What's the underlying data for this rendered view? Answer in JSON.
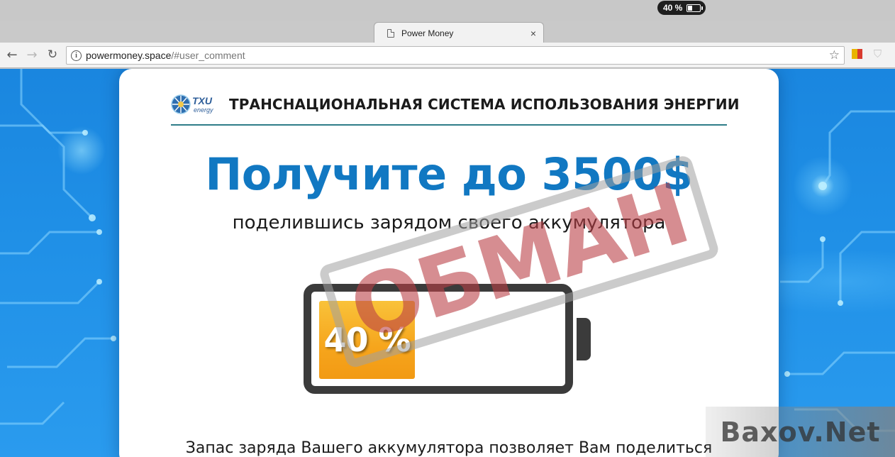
{
  "system": {
    "battery_text": "40 %",
    "battery_level": 0.4
  },
  "browser": {
    "tab": {
      "title": "Power Money",
      "close_glyph": "×",
      "icon": "page-icon"
    },
    "nav": {
      "back": "←",
      "forward": "→",
      "reload": "↻"
    },
    "address": {
      "host": "powermoney.space",
      "path": "/#user_comment",
      "info_glyph": "i",
      "star": "☆"
    },
    "extension_shield": "⛉"
  },
  "page": {
    "brand": {
      "logo_text_main": "TXU",
      "logo_text_sub": "energy",
      "title": "ТРАНСНАЦИОНАЛЬНАЯ СИСТЕМА ИСПОЛЬЗОВАНИЯ ЭНЕРГИИ"
    },
    "headline": "Получите до 3500$",
    "subline": "поделившись зарядом своего аккумулятора",
    "battery": {
      "percent_text": "40 %",
      "level": 0.4
    },
    "bottom_text": "Запас заряда Вашего аккумулятора позволяет Вам поделиться"
  },
  "overlay": {
    "stamp_text": "ОБМАН",
    "watermark_text": "Baxov.Net"
  },
  "colors": {
    "headline": "#1178c2",
    "battery_fill": "#f6a51c",
    "stamp": "#d72832",
    "background": "#1f8fe6",
    "brand_rule": "#2e7d88"
  }
}
